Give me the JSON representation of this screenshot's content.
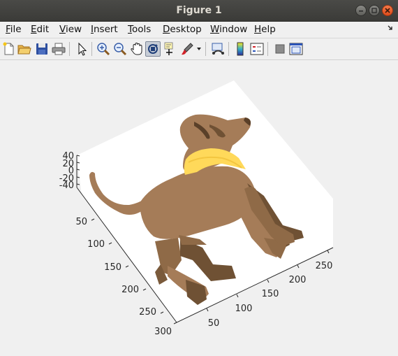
{
  "window": {
    "title": "Figure 1"
  },
  "menubar": {
    "items": [
      {
        "mnemonic": "F",
        "rest": "ile"
      },
      {
        "mnemonic": "E",
        "rest": "dit"
      },
      {
        "mnemonic": "V",
        "rest": "iew"
      },
      {
        "mnemonic": "I",
        "rest": "nsert"
      },
      {
        "mnemonic": "T",
        "rest": "ools"
      },
      {
        "mnemonic": "D",
        "rest": "esktop"
      },
      {
        "mnemonic": "W",
        "rest": "indow"
      },
      {
        "mnemonic": "H",
        "rest": "elp"
      }
    ]
  },
  "toolbar": {
    "buttons": [
      "new-figure",
      "open-file",
      "save-figure",
      "print-figure",
      "edit-plot",
      "zoom-in",
      "zoom-out",
      "pan",
      "rotate-3d",
      "data-cursor",
      "brush",
      "link-plot",
      "insert-colorbar",
      "insert-legend",
      "hide-plot-tools",
      "show-plot-tools"
    ],
    "active": "rotate-3d"
  },
  "axes": {
    "z_ticks": [
      "40",
      "20",
      "0",
      "-20",
      "-40"
    ],
    "y_ticks": [
      "50",
      "100",
      "150",
      "200",
      "250",
      "300"
    ],
    "x_ticks": [
      "50",
      "100",
      "150",
      "200",
      "250"
    ]
  },
  "colors": {
    "dog_body": "#a57c58",
    "dog_shadow": "#6f5134",
    "dog_dark": "#5a4029",
    "collar": "#ffd95a",
    "plot_background": "#ffffff"
  }
}
